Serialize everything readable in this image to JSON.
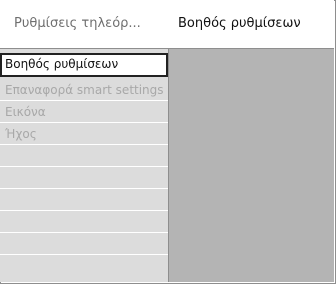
{
  "header": {
    "left_title": "Ρυθμίσεις τηλεόρ...",
    "right_title": "Βοηθός ρυθμίσεων"
  },
  "menu": {
    "items": [
      {
        "label": "Βοηθός ρυθμίσεων",
        "state": "selected"
      },
      {
        "label": "Επαναφορά smart settings",
        "state": "disabled"
      },
      {
        "label": "Εικόνα",
        "state": "disabled"
      },
      {
        "label": "Ήχος",
        "state": "disabled"
      },
      {
        "label": "",
        "state": "empty"
      },
      {
        "label": "",
        "state": "empty"
      },
      {
        "label": "",
        "state": "empty"
      },
      {
        "label": "",
        "state": "empty"
      },
      {
        "label": "",
        "state": "empty"
      }
    ]
  },
  "colors": {
    "menu_background": "#dcdcdc",
    "panel_background": "#b4b4b4",
    "disabled_text": "#a8a8a8",
    "selected_border": "#222222"
  }
}
